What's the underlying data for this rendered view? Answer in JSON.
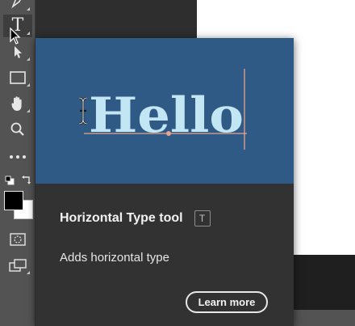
{
  "toolbar": {
    "tools": [
      {
        "name": "pen-tool",
        "icon": "pen-icon"
      },
      {
        "name": "type-tool",
        "icon": "type-icon",
        "active": true
      },
      {
        "name": "path-selection-tool",
        "icon": "arrow-select-icon"
      },
      {
        "name": "rectangle-tool",
        "icon": "rectangle-icon"
      },
      {
        "name": "hand-tool",
        "icon": "hand-icon"
      },
      {
        "name": "zoom-tool",
        "icon": "zoom-icon"
      },
      {
        "name": "edit-toolbar",
        "icon": "more-dots-icon"
      },
      {
        "name": "default-colors",
        "icon": "default-colors-icon"
      },
      {
        "name": "swap-colors",
        "icon": "swap-colors-icon"
      },
      {
        "name": "quick-mask",
        "icon": "quick-mask-icon"
      },
      {
        "name": "screen-mode",
        "icon": "screen-mode-icon"
      }
    ],
    "type_glyph": "T",
    "foreground_color": "#000000",
    "background_color": "#ffffff"
  },
  "tooltip": {
    "preview_text": "Hello",
    "title": "Horizontal Type tool",
    "shortcut": "T",
    "description": "Adds horizontal type",
    "learn_more_label": "Learn more",
    "preview_bg_color": "#2e5a85",
    "preview_text_color": "#c3e6f4",
    "guide_color": "#e8a48c"
  }
}
